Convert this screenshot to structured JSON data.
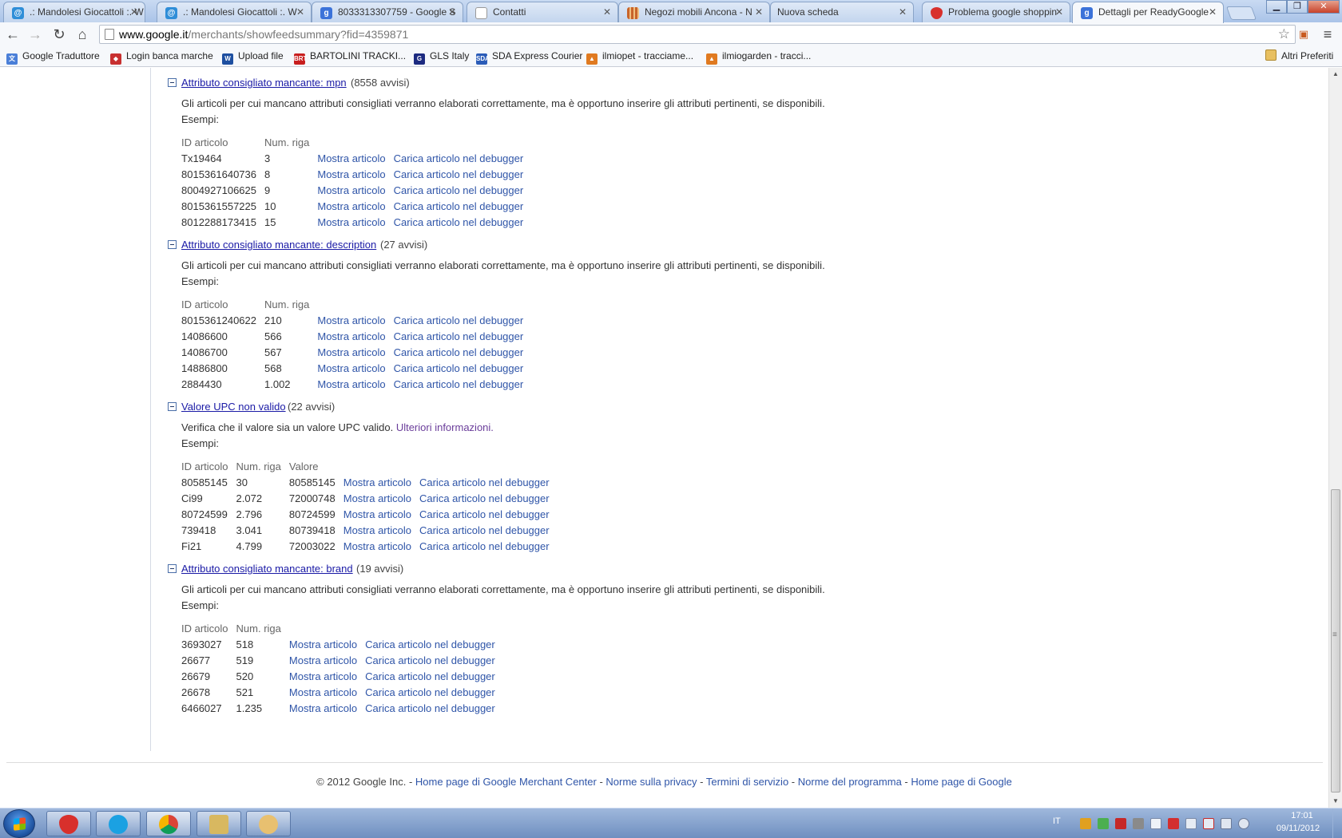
{
  "browser": {
    "tabs": [
      {
        "title": ".: Mandolesi Giocattoli :. W",
        "icon": "site-swirl-icon",
        "color": "#2f8ed8"
      },
      {
        "title": ".: Mandolesi Giocattoli :. W",
        "icon": "site-swirl-icon",
        "color": "#2f8ed8"
      },
      {
        "title": "8033313307759 - Google S",
        "icon": "google-icon",
        "color": "#3b72d9"
      },
      {
        "title": "Contatti",
        "icon": "blank-page-icon",
        "color": "#ffffff"
      },
      {
        "title": "Negozi mobili Ancona - N",
        "icon": "stripes-icon",
        "color": "#c8642a"
      },
      {
        "title": "Nuova scheda",
        "icon": "none",
        "color": ""
      },
      {
        "title": "Problema google shoppin",
        "icon": "strawberry-icon",
        "color": "#d8302c"
      },
      {
        "title": "Dettagli per ReadyGoogle",
        "icon": "google-icon",
        "color": "#3b72d9"
      }
    ],
    "url_host": "www.google.it",
    "url_path": "/merchants/showfeedsummary?fid=4359871",
    "bookmarks": [
      {
        "label": "Google Traduttore",
        "icon": "translate-icon",
        "color": "#4a7fd8"
      },
      {
        "label": "Login banca marche",
        "icon": "bank-icon",
        "color": "#c83030"
      },
      {
        "label": "Upload file",
        "icon": "w-icon",
        "color": "#1e4fa0"
      },
      {
        "label": "BARTOLINI TRACKI...",
        "icon": "brt-icon",
        "color": "#c81e1e"
      },
      {
        "label": "GLS Italy",
        "icon": "gls-icon",
        "color": "#1c2a80"
      },
      {
        "label": "SDA Express Courier",
        "icon": "sda-icon",
        "color": "#2b5cb8"
      },
      {
        "label": "ilmiopet - tracciame...",
        "icon": "rss-icon",
        "color": "#e07a20"
      },
      {
        "label": "ilmiogarden - tracci...",
        "icon": "rss-icon",
        "color": "#e07a20"
      }
    ],
    "other_bookmarks": "Altri Preferiti"
  },
  "columns": {
    "id": "ID articolo",
    "row": "Num. riga",
    "value": "Valore"
  },
  "link_labels": {
    "show": "Mostra articolo",
    "debug": "Carica articolo nel debugger"
  },
  "sections": [
    {
      "title": "Attributo consigliato mancante: mpn",
      "count": "(8558 avvisi)",
      "description": "Gli articoli per cui mancano attributi consigliati verranno elaborati correttamente, ma è opportuno inserire gli attributi pertinenti, se disponibili.",
      "examples_label": "Esempi:",
      "rows": [
        {
          "id": "Tx19464",
          "row": "3"
        },
        {
          "id": "8015361640736",
          "row": "8"
        },
        {
          "id": "8004927106625",
          "row": "9"
        },
        {
          "id": "8015361557225",
          "row": "10"
        },
        {
          "id": "8012288173415",
          "row": "15"
        }
      ]
    },
    {
      "title": "Attributo consigliato mancante: description",
      "count": "(27 avvisi)",
      "description": "Gli articoli per cui mancano attributi consigliati verranno elaborati correttamente, ma è opportuno inserire gli attributi pertinenti, se disponibili.",
      "examples_label": "Esempi:",
      "rows": [
        {
          "id": "8015361240622",
          "row": "210"
        },
        {
          "id": "14086600",
          "row": "566"
        },
        {
          "id": "14086700",
          "row": "567"
        },
        {
          "id": "14886800",
          "row": "568"
        },
        {
          "id": "2884430",
          "row": "1.002"
        }
      ]
    },
    {
      "title": "Valore UPC non valido",
      "count": "(22 avvisi)",
      "description": "Verifica che il valore sia un valore UPC valido.",
      "more_info": "Ulteriori informazioni.",
      "examples_label": "Esempi:",
      "rows": [
        {
          "id": "80585145",
          "row": "30",
          "value": "80585145"
        },
        {
          "id": "Ci99",
          "row": "2.072",
          "value": "72000748"
        },
        {
          "id": "80724599",
          "row": "2.796",
          "value": "80724599"
        },
        {
          "id": "739418",
          "row": "3.041",
          "value": "80739418"
        },
        {
          "id": "Fi21",
          "row": "4.799",
          "value": "72003022"
        }
      ]
    },
    {
      "title": "Attributo consigliato mancante: brand",
      "count": "(19 avvisi)",
      "description": "Gli articoli per cui mancano attributi consigliati verranno elaborati correttamente, ma è opportuno inserire gli attributi pertinenti, se disponibili.",
      "examples_label": "Esempi:",
      "rows": [
        {
          "id": "3693027",
          "row": "518"
        },
        {
          "id": "26677",
          "row": "519"
        },
        {
          "id": "26679",
          "row": "520"
        },
        {
          "id": "26678",
          "row": "521"
        },
        {
          "id": "6466027",
          "row": "1.235"
        }
      ]
    }
  ],
  "footer": {
    "copyright": "© 2012 Google Inc.",
    "links": [
      "Home page di Google Merchant Center",
      "Norme sulla privacy",
      "Termini di servizio",
      "Norme del programma",
      "Home page di Google"
    ]
  },
  "taskbar": {
    "apps": [
      {
        "icon": "strawberry-icon",
        "color": "#d8302c"
      },
      {
        "icon": "skype-icon",
        "color": "#1ba1e2"
      },
      {
        "icon": "chrome-icon",
        "color": "#e2b31b"
      },
      {
        "icon": "explorer-icon",
        "color": "#d8b860"
      },
      {
        "icon": "paint-icon",
        "color": "#e8c070"
      }
    ],
    "language": "IT",
    "time": "17:01",
    "date": "09/11/2012"
  }
}
